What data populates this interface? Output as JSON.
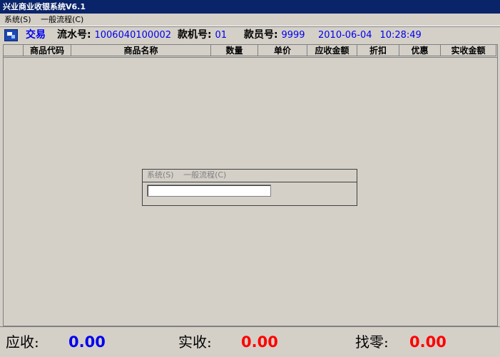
{
  "window": {
    "title": "兴业商业收银系统V6.1"
  },
  "menu": {
    "system": "系统(S)",
    "flow": "一般流程(C)"
  },
  "info": {
    "mode": "交易",
    "serial_label": "流水号:",
    "serial_value": "1006040100002",
    "machine_label": "款机号:",
    "machine_value": "01",
    "cashier_label": "款员号:",
    "cashier_value": "9999",
    "date": "2010-06-04",
    "time": "10:28:49"
  },
  "table": {
    "columns": [
      "商品代码",
      "商品名称",
      "数量",
      "单价",
      "应收金额",
      "折扣",
      "优惠",
      "实收金额"
    ],
    "rows": []
  },
  "dialog": {
    "menu_system": "系统(S)",
    "menu_flow": "一般流程(C)",
    "input_value": ""
  },
  "totals": {
    "receivable_label": "应收:",
    "receivable_value": "0.00",
    "received_label": "实收:",
    "received_value": "0.00",
    "change_label": "找零:",
    "change_value": "0.00"
  },
  "colors": {
    "title_bg": "#0a246a",
    "info_value": "#0000ee",
    "receivable": "#0000ee",
    "received": "#ff0000",
    "change": "#ff0000"
  }
}
